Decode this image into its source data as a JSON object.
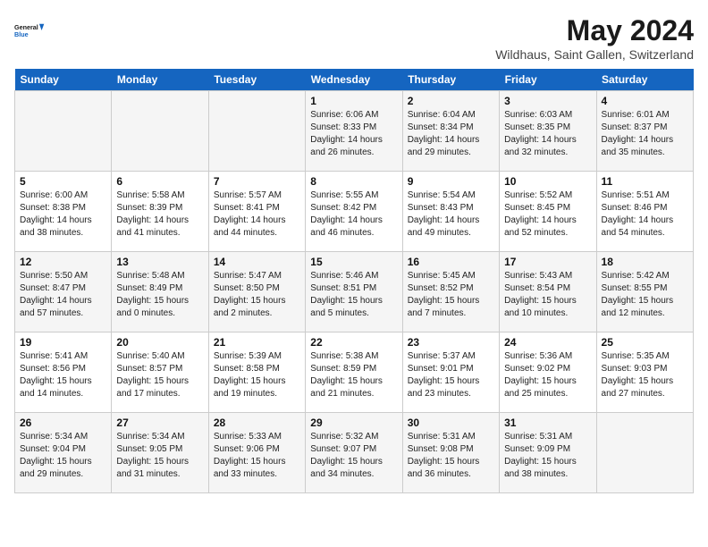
{
  "header": {
    "logo_line1": "General",
    "logo_line2": "Blue",
    "month_year": "May 2024",
    "location": "Wildhaus, Saint Gallen, Switzerland"
  },
  "weekdays": [
    "Sunday",
    "Monday",
    "Tuesday",
    "Wednesday",
    "Thursday",
    "Friday",
    "Saturday"
  ],
  "weeks": [
    [
      {
        "day": "",
        "info": ""
      },
      {
        "day": "",
        "info": ""
      },
      {
        "day": "",
        "info": ""
      },
      {
        "day": "1",
        "info": "Sunrise: 6:06 AM\nSunset: 8:33 PM\nDaylight: 14 hours\nand 26 minutes."
      },
      {
        "day": "2",
        "info": "Sunrise: 6:04 AM\nSunset: 8:34 PM\nDaylight: 14 hours\nand 29 minutes."
      },
      {
        "day": "3",
        "info": "Sunrise: 6:03 AM\nSunset: 8:35 PM\nDaylight: 14 hours\nand 32 minutes."
      },
      {
        "day": "4",
        "info": "Sunrise: 6:01 AM\nSunset: 8:37 PM\nDaylight: 14 hours\nand 35 minutes."
      }
    ],
    [
      {
        "day": "5",
        "info": "Sunrise: 6:00 AM\nSunset: 8:38 PM\nDaylight: 14 hours\nand 38 minutes."
      },
      {
        "day": "6",
        "info": "Sunrise: 5:58 AM\nSunset: 8:39 PM\nDaylight: 14 hours\nand 41 minutes."
      },
      {
        "day": "7",
        "info": "Sunrise: 5:57 AM\nSunset: 8:41 PM\nDaylight: 14 hours\nand 44 minutes."
      },
      {
        "day": "8",
        "info": "Sunrise: 5:55 AM\nSunset: 8:42 PM\nDaylight: 14 hours\nand 46 minutes."
      },
      {
        "day": "9",
        "info": "Sunrise: 5:54 AM\nSunset: 8:43 PM\nDaylight: 14 hours\nand 49 minutes."
      },
      {
        "day": "10",
        "info": "Sunrise: 5:52 AM\nSunset: 8:45 PM\nDaylight: 14 hours\nand 52 minutes."
      },
      {
        "day": "11",
        "info": "Sunrise: 5:51 AM\nSunset: 8:46 PM\nDaylight: 14 hours\nand 54 minutes."
      }
    ],
    [
      {
        "day": "12",
        "info": "Sunrise: 5:50 AM\nSunset: 8:47 PM\nDaylight: 14 hours\nand 57 minutes."
      },
      {
        "day": "13",
        "info": "Sunrise: 5:48 AM\nSunset: 8:49 PM\nDaylight: 15 hours\nand 0 minutes."
      },
      {
        "day": "14",
        "info": "Sunrise: 5:47 AM\nSunset: 8:50 PM\nDaylight: 15 hours\nand 2 minutes."
      },
      {
        "day": "15",
        "info": "Sunrise: 5:46 AM\nSunset: 8:51 PM\nDaylight: 15 hours\nand 5 minutes."
      },
      {
        "day": "16",
        "info": "Sunrise: 5:45 AM\nSunset: 8:52 PM\nDaylight: 15 hours\nand 7 minutes."
      },
      {
        "day": "17",
        "info": "Sunrise: 5:43 AM\nSunset: 8:54 PM\nDaylight: 15 hours\nand 10 minutes."
      },
      {
        "day": "18",
        "info": "Sunrise: 5:42 AM\nSunset: 8:55 PM\nDaylight: 15 hours\nand 12 minutes."
      }
    ],
    [
      {
        "day": "19",
        "info": "Sunrise: 5:41 AM\nSunset: 8:56 PM\nDaylight: 15 hours\nand 14 minutes."
      },
      {
        "day": "20",
        "info": "Sunrise: 5:40 AM\nSunset: 8:57 PM\nDaylight: 15 hours\nand 17 minutes."
      },
      {
        "day": "21",
        "info": "Sunrise: 5:39 AM\nSunset: 8:58 PM\nDaylight: 15 hours\nand 19 minutes."
      },
      {
        "day": "22",
        "info": "Sunrise: 5:38 AM\nSunset: 8:59 PM\nDaylight: 15 hours\nand 21 minutes."
      },
      {
        "day": "23",
        "info": "Sunrise: 5:37 AM\nSunset: 9:01 PM\nDaylight: 15 hours\nand 23 minutes."
      },
      {
        "day": "24",
        "info": "Sunrise: 5:36 AM\nSunset: 9:02 PM\nDaylight: 15 hours\nand 25 minutes."
      },
      {
        "day": "25",
        "info": "Sunrise: 5:35 AM\nSunset: 9:03 PM\nDaylight: 15 hours\nand 27 minutes."
      }
    ],
    [
      {
        "day": "26",
        "info": "Sunrise: 5:34 AM\nSunset: 9:04 PM\nDaylight: 15 hours\nand 29 minutes."
      },
      {
        "day": "27",
        "info": "Sunrise: 5:34 AM\nSunset: 9:05 PM\nDaylight: 15 hours\nand 31 minutes."
      },
      {
        "day": "28",
        "info": "Sunrise: 5:33 AM\nSunset: 9:06 PM\nDaylight: 15 hours\nand 33 minutes."
      },
      {
        "day": "29",
        "info": "Sunrise: 5:32 AM\nSunset: 9:07 PM\nDaylight: 15 hours\nand 34 minutes."
      },
      {
        "day": "30",
        "info": "Sunrise: 5:31 AM\nSunset: 9:08 PM\nDaylight: 15 hours\nand 36 minutes."
      },
      {
        "day": "31",
        "info": "Sunrise: 5:31 AM\nSunset: 9:09 PM\nDaylight: 15 hours\nand 38 minutes."
      },
      {
        "day": "",
        "info": ""
      }
    ]
  ]
}
